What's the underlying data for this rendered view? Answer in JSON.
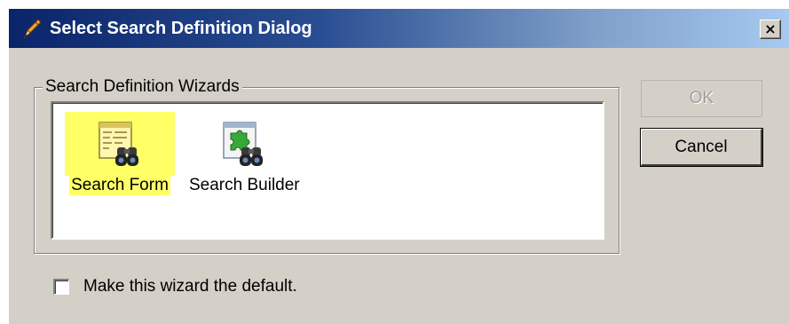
{
  "dialog": {
    "title": "Select Search Definition Dialog",
    "close_label": "×",
    "title_icon": "pencil-icon"
  },
  "wizards": {
    "group_label": "Search Definition Wizards",
    "items": [
      {
        "label": "Search Form",
        "icon": "search-form-icon",
        "selected": true
      },
      {
        "label": "Search Builder",
        "icon": "search-builder-icon",
        "selected": false
      }
    ]
  },
  "buttons": {
    "ok_label": "OK",
    "ok_enabled": false,
    "cancel_label": "Cancel"
  },
  "default_option": {
    "label": "Make this wizard the default.",
    "checked": false
  },
  "colors": {
    "title_gradient_start": "#0a246a",
    "title_gradient_end": "#a6caf0",
    "dialog_face": "#d4d0c8",
    "selection_highlight": "#ffff66"
  }
}
